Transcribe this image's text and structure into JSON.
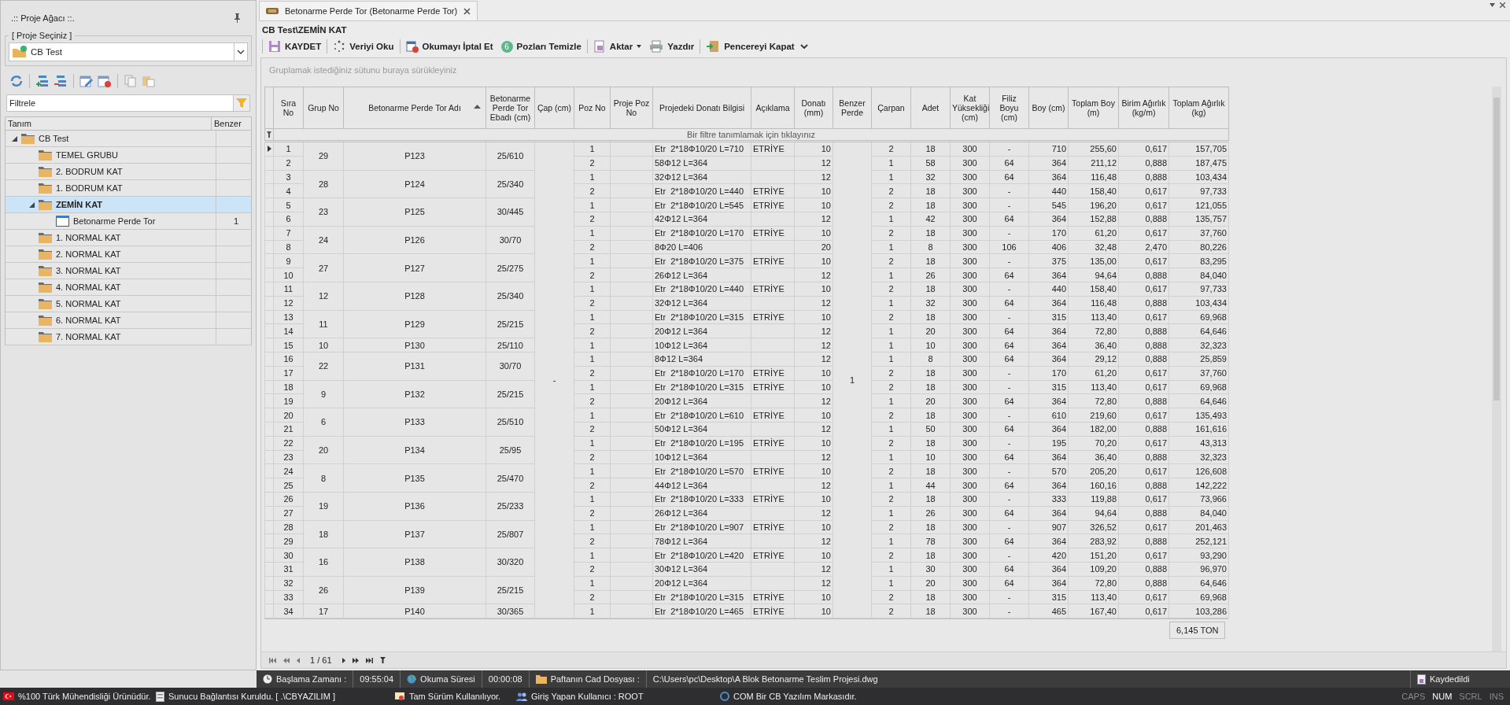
{
  "left_panel": {
    "title": ".:: Proje Ağacı ::.",
    "project_group": {
      "legend": "[ Proje Seçiniz ]",
      "value": "CB Test"
    },
    "filter": {
      "placeholder": "Filtrele"
    },
    "tree": {
      "columns": [
        "Tanım",
        "Benzer"
      ],
      "items": [
        {
          "label": "CB Test",
          "kind": "folder",
          "expanded": true,
          "selected": false,
          "children": [
            {
              "label": "TEMEL GRUBU",
              "kind": "folder",
              "selected": false
            },
            {
              "label": "2. BODRUM KAT",
              "kind": "folder",
              "selected": false
            },
            {
              "label": "1. BODRUM KAT",
              "kind": "folder",
              "selected": false
            },
            {
              "label": "ZEMİN KAT",
              "kind": "folder",
              "expanded": true,
              "selected": true,
              "children": [
                {
                  "label": "Betonarme Perde Tor",
                  "kind": "document",
                  "benzer": "1",
                  "selected": false
                }
              ]
            },
            {
              "label": "1. NORMAL KAT",
              "kind": "folder",
              "selected": false
            },
            {
              "label": "2. NORMAL KAT",
              "kind": "folder",
              "selected": false
            },
            {
              "label": "3. NORMAL KAT",
              "kind": "folder",
              "selected": false
            },
            {
              "label": "4. NORMAL KAT",
              "kind": "folder",
              "selected": false
            },
            {
              "label": "5. NORMAL KAT",
              "kind": "folder",
              "selected": false
            },
            {
              "label": "6. NORMAL KAT",
              "kind": "folder",
              "selected": false
            },
            {
              "label": "7. NORMAL KAT",
              "kind": "folder",
              "selected": false
            }
          ]
        }
      ]
    }
  },
  "tab": {
    "title": "Betonarme Perde Tor (Betonarme Perde Tor)"
  },
  "breadcrumb": "CB Test\\ZEMİN KAT",
  "toolbar": [
    {
      "kind": "save",
      "label": "KAYDET"
    },
    {
      "kind": "read",
      "label": "Veriyi Oku"
    },
    {
      "kind": "cancel",
      "label": "Okumayı İptal Et"
    },
    {
      "kind": "badge",
      "badge": "6",
      "label": "Pozları Temizle"
    },
    {
      "kind": "export",
      "label": "Aktar",
      "dropdown": true
    },
    {
      "kind": "print",
      "label": "Yazdır"
    },
    {
      "kind": "exit",
      "label": "Pencereyi Kapat"
    }
  ],
  "grid": {
    "group_hint": "Gruplamak istediğiniz sütunu buraya sürükleyiniz",
    "filter_hint": "Bir filtre tanımlamak için tıklayınız",
    "columns": [
      {
        "label": "Sıra No",
        "sorted": false
      },
      {
        "label": "Grup No",
        "sorted": false
      },
      {
        "label": "Betonarme Perde Tor Adı",
        "sorted": true
      },
      {
        "label": "Betonarme Perde Tor Ebadı (cm)",
        "sorted": false
      },
      {
        "label": "Çap (cm)",
        "sorted": false
      },
      {
        "label": "Poz No",
        "sorted": false
      },
      {
        "label": "Proje Poz No",
        "sorted": false
      },
      {
        "label": "Projedeki Donatı Bilgisi",
        "sorted": false
      },
      {
        "label": "Açıklama",
        "sorted": false
      },
      {
        "label": "Donatı (mm)",
        "sorted": false
      },
      {
        "label": "Benzer Perde",
        "sorted": false
      },
      {
        "label": "Çarpan",
        "sorted": false
      },
      {
        "label": "Adet",
        "sorted": false
      },
      {
        "label": "Kat Yüksekliği (cm)",
        "sorted": false
      },
      {
        "label": "Filiz Boyu (cm)",
        "sorted": false
      },
      {
        "label": "Boy (cm)",
        "sorted": false
      },
      {
        "label": "Toplam Boy (m)",
        "sorted": false
      },
      {
        "label": "Birim Ağırlık (kg/m)",
        "sorted": false
      },
      {
        "label": "Toplam Ağırlık (kg)",
        "sorted": false
      }
    ],
    "cap": "-",
    "benzer_perde": "1",
    "groups": [
      {
        "grup_no": "29",
        "adi": "P123",
        "ebadi": "25/610",
        "rows": [
          {
            "sira": "1",
            "poz": "1",
            "bilgi": "Etr  2*18Φ10/20 L=710",
            "aciklama": "ETRİYE",
            "donati": "10",
            "carpan": "2",
            "adet": "18",
            "kat": "300",
            "filiz": "-",
            "boy": "710",
            "toplam_boy": "255,60",
            "birim": "0,617",
            "toplam": "157,705",
            "focused": true
          },
          {
            "sira": "2",
            "poz": "2",
            "bilgi": "58Φ12 L=364",
            "donati": "12",
            "carpan": "1",
            "adet": "58",
            "kat": "300",
            "filiz": "64",
            "boy": "364",
            "toplam_boy": "211,12",
            "birim": "0,888",
            "toplam": "187,475",
            "focused": false
          }
        ]
      },
      {
        "grup_no": "28",
        "adi": "P124",
        "ebadi": "25/340",
        "rows": [
          {
            "sira": "3",
            "poz": "1",
            "bilgi": "32Φ12 L=364",
            "donati": "12",
            "carpan": "1",
            "adet": "32",
            "kat": "300",
            "filiz": "64",
            "boy": "364",
            "toplam_boy": "116,48",
            "birim": "0,888",
            "toplam": "103,434",
            "focused": false
          },
          {
            "sira": "4",
            "poz": "2",
            "bilgi": "Etr  2*18Φ10/20 L=440",
            "aciklama": "ETRİYE",
            "donati": "10",
            "carpan": "2",
            "adet": "18",
            "kat": "300",
            "filiz": "-",
            "boy": "440",
            "toplam_boy": "158,40",
            "birim": "0,617",
            "toplam": "97,733",
            "focused": false
          }
        ]
      },
      {
        "grup_no": "23",
        "adi": "P125",
        "ebadi": "30/445",
        "rows": [
          {
            "sira": "5",
            "poz": "1",
            "bilgi": "Etr  2*18Φ10/20 L=545",
            "aciklama": "ETRİYE",
            "donati": "10",
            "carpan": "2",
            "adet": "18",
            "kat": "300",
            "filiz": "-",
            "boy": "545",
            "toplam_boy": "196,20",
            "birim": "0,617",
            "toplam": "121,055",
            "focused": false
          },
          {
            "sira": "6",
            "poz": "2",
            "bilgi": "42Φ12 L=364",
            "donati": "12",
            "carpan": "1",
            "adet": "42",
            "kat": "300",
            "filiz": "64",
            "boy": "364",
            "toplam_boy": "152,88",
            "birim": "0,888",
            "toplam": "135,757",
            "focused": false
          }
        ]
      },
      {
        "grup_no": "24",
        "adi": "P126",
        "ebadi": "30/70",
        "rows": [
          {
            "sira": "7",
            "poz": "1",
            "bilgi": "Etr  2*18Φ10/20 L=170",
            "aciklama": "ETRİYE",
            "donati": "10",
            "carpan": "2",
            "adet": "18",
            "kat": "300",
            "filiz": "-",
            "boy": "170",
            "toplam_boy": "61,20",
            "birim": "0,617",
            "toplam": "37,760",
            "focused": false
          },
          {
            "sira": "8",
            "poz": "2",
            "bilgi": "8Φ20 L=406",
            "donati": "20",
            "carpan": "1",
            "adet": "8",
            "kat": "300",
            "filiz": "106",
            "boy": "406",
            "toplam_boy": "32,48",
            "birim": "2,470",
            "toplam": "80,226",
            "focused": false
          }
        ]
      },
      {
        "grup_no": "27",
        "adi": "P127",
        "ebadi": "25/275",
        "rows": [
          {
            "sira": "9",
            "poz": "1",
            "bilgi": "Etr  2*18Φ10/20 L=375",
            "aciklama": "ETRİYE",
            "donati": "10",
            "carpan": "2",
            "adet": "18",
            "kat": "300",
            "filiz": "-",
            "boy": "375",
            "toplam_boy": "135,00",
            "birim": "0,617",
            "toplam": "83,295",
            "focused": false
          },
          {
            "sira": "10",
            "poz": "2",
            "bilgi": "26Φ12 L=364",
            "donati": "12",
            "carpan": "1",
            "adet": "26",
            "kat": "300",
            "filiz": "64",
            "boy": "364",
            "toplam_boy": "94,64",
            "birim": "0,888",
            "toplam": "84,040",
            "focused": false
          }
        ]
      },
      {
        "grup_no": "12",
        "adi": "P128",
        "ebadi": "25/340",
        "rows": [
          {
            "sira": "11",
            "poz": "1",
            "bilgi": "Etr  2*18Φ10/20 L=440",
            "aciklama": "ETRİYE",
            "donati": "10",
            "carpan": "2",
            "adet": "18",
            "kat": "300",
            "filiz": "-",
            "boy": "440",
            "toplam_boy": "158,40",
            "birim": "0,617",
            "toplam": "97,733",
            "focused": false
          },
          {
            "sira": "12",
            "poz": "2",
            "bilgi": "32Φ12 L=364",
            "donati": "12",
            "carpan": "1",
            "adet": "32",
            "kat": "300",
            "filiz": "64",
            "boy": "364",
            "toplam_boy": "116,48",
            "birim": "0,888",
            "toplam": "103,434",
            "focused": false
          }
        ]
      },
      {
        "grup_no": "11",
        "adi": "P129",
        "ebadi": "25/215",
        "rows": [
          {
            "sira": "13",
            "poz": "1",
            "bilgi": "Etr  2*18Φ10/20 L=315",
            "aciklama": "ETRİYE",
            "donati": "10",
            "carpan": "2",
            "adet": "18",
            "kat": "300",
            "filiz": "-",
            "boy": "315",
            "toplam_boy": "113,40",
            "birim": "0,617",
            "toplam": "69,968",
            "focused": false
          },
          {
            "sira": "14",
            "poz": "2",
            "bilgi": "20Φ12 L=364",
            "donati": "12",
            "carpan": "1",
            "adet": "20",
            "kat": "300",
            "filiz": "64",
            "boy": "364",
            "toplam_boy": "72,80",
            "birim": "0,888",
            "toplam": "64,646",
            "focused": false
          }
        ]
      },
      {
        "grup_no": "10",
        "adi": "P130",
        "ebadi": "25/110",
        "rows": [
          {
            "sira": "15",
            "poz": "1",
            "bilgi": "10Φ12 L=364",
            "donati": "12",
            "carpan": "1",
            "adet": "10",
            "kat": "300",
            "filiz": "64",
            "boy": "364",
            "toplam_boy": "36,40",
            "birim": "0,888",
            "toplam": "32,323",
            "focused": false
          }
        ]
      },
      {
        "grup_no": "22",
        "adi": "P131",
        "ebadi": "30/70",
        "rows": [
          {
            "sira": "16",
            "poz": "1",
            "bilgi": "8Φ12 L=364",
            "donati": "12",
            "carpan": "1",
            "adet": "8",
            "kat": "300",
            "filiz": "64",
            "boy": "364",
            "toplam_boy": "29,12",
            "birim": "0,888",
            "toplam": "25,859",
            "focused": false
          },
          {
            "sira": "17",
            "poz": "2",
            "bilgi": "Etr  2*18Φ10/20 L=170",
            "aciklama": "ETRİYE",
            "donati": "10",
            "carpan": "2",
            "adet": "18",
            "kat": "300",
            "filiz": "-",
            "boy": "170",
            "toplam_boy": "61,20",
            "birim": "0,617",
            "toplam": "37,760",
            "focused": false
          }
        ]
      },
      {
        "grup_no": "9",
        "adi": "P132",
        "ebadi": "25/215",
        "rows": [
          {
            "sira": "18",
            "poz": "1",
            "bilgi": "Etr  2*18Φ10/20 L=315",
            "aciklama": "ETRİYE",
            "donati": "10",
            "carpan": "2",
            "adet": "18",
            "kat": "300",
            "filiz": "-",
            "boy": "315",
            "toplam_boy": "113,40",
            "birim": "0,617",
            "toplam": "69,968",
            "focused": false
          },
          {
            "sira": "19",
            "poz": "2",
            "bilgi": "20Φ12 L=364",
            "donati": "12",
            "carpan": "1",
            "adet": "20",
            "kat": "300",
            "filiz": "64",
            "boy": "364",
            "toplam_boy": "72,80",
            "birim": "0,888",
            "toplam": "64,646",
            "focused": false
          }
        ]
      },
      {
        "grup_no": "6",
        "adi": "P133",
        "ebadi": "25/510",
        "rows": [
          {
            "sira": "20",
            "poz": "1",
            "bilgi": "Etr  2*18Φ10/20 L=610",
            "aciklama": "ETRİYE",
            "donati": "10",
            "carpan": "2",
            "adet": "18",
            "kat": "300",
            "filiz": "-",
            "boy": "610",
            "toplam_boy": "219,60",
            "birim": "0,617",
            "toplam": "135,493",
            "focused": false
          },
          {
            "sira": "21",
            "poz": "2",
            "bilgi": "50Φ12 L=364",
            "donati": "12",
            "carpan": "1",
            "adet": "50",
            "kat": "300",
            "filiz": "64",
            "boy": "364",
            "toplam_boy": "182,00",
            "birim": "0,888",
            "toplam": "161,616",
            "focused": false
          }
        ]
      },
      {
        "grup_no": "20",
        "adi": "P134",
        "ebadi": "25/95",
        "rows": [
          {
            "sira": "22",
            "poz": "1",
            "bilgi": "Etr  2*18Φ10/20 L=195",
            "aciklama": "ETRİYE",
            "donati": "10",
            "carpan": "2",
            "adet": "18",
            "kat": "300",
            "filiz": "-",
            "boy": "195",
            "toplam_boy": "70,20",
            "birim": "0,617",
            "toplam": "43,313",
            "focused": false
          },
          {
            "sira": "23",
            "poz": "2",
            "bilgi": "10Φ12 L=364",
            "donati": "12",
            "carpan": "1",
            "adet": "10",
            "kat": "300",
            "filiz": "64",
            "boy": "364",
            "toplam_boy": "36,40",
            "birim": "0,888",
            "toplam": "32,323",
            "focused": false
          }
        ]
      },
      {
        "grup_no": "8",
        "adi": "P135",
        "ebadi": "25/470",
        "rows": [
          {
            "sira": "24",
            "poz": "1",
            "bilgi": "Etr  2*18Φ10/20 L=570",
            "aciklama": "ETRİYE",
            "donati": "10",
            "carpan": "2",
            "adet": "18",
            "kat": "300",
            "filiz": "-",
            "boy": "570",
            "toplam_boy": "205,20",
            "birim": "0,617",
            "toplam": "126,608",
            "focused": false
          },
          {
            "sira": "25",
            "poz": "2",
            "bilgi": "44Φ12 L=364",
            "donati": "12",
            "carpan": "1",
            "adet": "44",
            "kat": "300",
            "filiz": "64",
            "boy": "364",
            "toplam_boy": "160,16",
            "birim": "0,888",
            "toplam": "142,222",
            "focused": false
          }
        ]
      },
      {
        "grup_no": "19",
        "adi": "P136",
        "ebadi": "25/233",
        "rows": [
          {
            "sira": "26",
            "poz": "1",
            "bilgi": "Etr  2*18Φ10/20 L=333",
            "aciklama": "ETRİYE",
            "donati": "10",
            "carpan": "2",
            "adet": "18",
            "kat": "300",
            "filiz": "-",
            "boy": "333",
            "toplam_boy": "119,88",
            "birim": "0,617",
            "toplam": "73,966",
            "focused": false
          },
          {
            "sira": "27",
            "poz": "2",
            "bilgi": "26Φ12 L=364",
            "donati": "12",
            "carpan": "1",
            "adet": "26",
            "kat": "300",
            "filiz": "64",
            "boy": "364",
            "toplam_boy": "94,64",
            "birim": "0,888",
            "toplam": "84,040",
            "focused": false
          }
        ]
      },
      {
        "grup_no": "18",
        "adi": "P137",
        "ebadi": "25/807",
        "rows": [
          {
            "sira": "28",
            "poz": "1",
            "bilgi": "Etr  2*18Φ10/20 L=907",
            "aciklama": "ETRİYE",
            "donati": "10",
            "carpan": "2",
            "adet": "18",
            "kat": "300",
            "filiz": "-",
            "boy": "907",
            "toplam_boy": "326,52",
            "birim": "0,617",
            "toplam": "201,463",
            "focused": false
          },
          {
            "sira": "29",
            "poz": "2",
            "bilgi": "78Φ12 L=364",
            "donati": "12",
            "carpan": "1",
            "adet": "78",
            "kat": "300",
            "filiz": "64",
            "boy": "364",
            "toplam_boy": "283,92",
            "birim": "0,888",
            "toplam": "252,121",
            "focused": false
          }
        ]
      },
      {
        "grup_no": "16",
        "adi": "P138",
        "ebadi": "30/320",
        "rows": [
          {
            "sira": "30",
            "poz": "1",
            "bilgi": "Etr  2*18Φ10/20 L=420",
            "aciklama": "ETRİYE",
            "donati": "10",
            "carpan": "2",
            "adet": "18",
            "kat": "300",
            "filiz": "-",
            "boy": "420",
            "toplam_boy": "151,20",
            "birim": "0,617",
            "toplam": "93,290",
            "focused": false
          },
          {
            "sira": "31",
            "poz": "2",
            "bilgi": "30Φ12 L=364",
            "donati": "12",
            "carpan": "1",
            "adet": "30",
            "kat": "300",
            "filiz": "64",
            "boy": "364",
            "toplam_boy": "109,20",
            "birim": "0,888",
            "toplam": "96,970",
            "focused": false
          }
        ]
      },
      {
        "grup_no": "26",
        "adi": "P139",
        "ebadi": "25/215",
        "rows": [
          {
            "sira": "32",
            "poz": "1",
            "bilgi": "20Φ12 L=364",
            "donati": "12",
            "carpan": "1",
            "adet": "20",
            "kat": "300",
            "filiz": "64",
            "boy": "364",
            "toplam_boy": "72,80",
            "birim": "0,888",
            "toplam": "64,646",
            "focused": false
          },
          {
            "sira": "33",
            "poz": "2",
            "bilgi": "Etr  2*18Φ10/20 L=315",
            "aciklama": "ETRİYE",
            "donati": "10",
            "carpan": "2",
            "adet": "18",
            "kat": "300",
            "filiz": "-",
            "boy": "315",
            "toplam_boy": "113,40",
            "birim": "0,617",
            "toplam": "69,968",
            "focused": false
          }
        ]
      },
      {
        "grup_no": "17",
        "adi": "P140",
        "ebadi": "30/365",
        "rows": [
          {
            "sira": "34",
            "poz": "1",
            "bilgi": "Etr  2*18Φ10/20 L=465",
            "aciklama": "ETRİYE",
            "donati": "10",
            "carpan": "2",
            "adet": "18",
            "kat": "300",
            "filiz": "-",
            "boy": "465",
            "toplam_boy": "167,40",
            "birim": "0,617",
            "toplam": "103,286",
            "focused": false
          }
        ]
      }
    ],
    "total": "6,145 TON",
    "pager": "1 / 61"
  },
  "status_bar": {
    "start_label": "Başlama Zamanı :",
    "start_time": "09:55:04",
    "read_label": "Okuma Süresi",
    "read_time": "00:00:08",
    "file_label": "Paftanın Cad Dosyası :",
    "file_path": "C:\\Users\\pc\\Desktop\\A Blok  Betonarme Teslim Projesi.dwg",
    "saved": "Kaydedildi"
  },
  "bottom_bar": {
    "messages": [
      {
        "kind": "flag",
        "text": "%100 Türk Mühendisliği Ürünüdür."
      },
      {
        "kind": "server",
        "text": "Sunucu Bağlantısı Kuruldu. [ .\\CBYAZILIM ]"
      },
      {
        "kind": "license",
        "text": "Tam Sürüm Kullanılıyor."
      },
      {
        "kind": "user",
        "text": "Giriş Yapan Kullanıcı : ROOT"
      },
      {
        "kind": "brand",
        "text": "COM Bir CB Yazılım Markasıdır."
      }
    ],
    "keys": [
      {
        "label": "CAPS",
        "on": false
      },
      {
        "label": "NUM",
        "on": true
      },
      {
        "label": "SCRL",
        "on": false
      },
      {
        "label": "INS",
        "on": false
      }
    ]
  }
}
